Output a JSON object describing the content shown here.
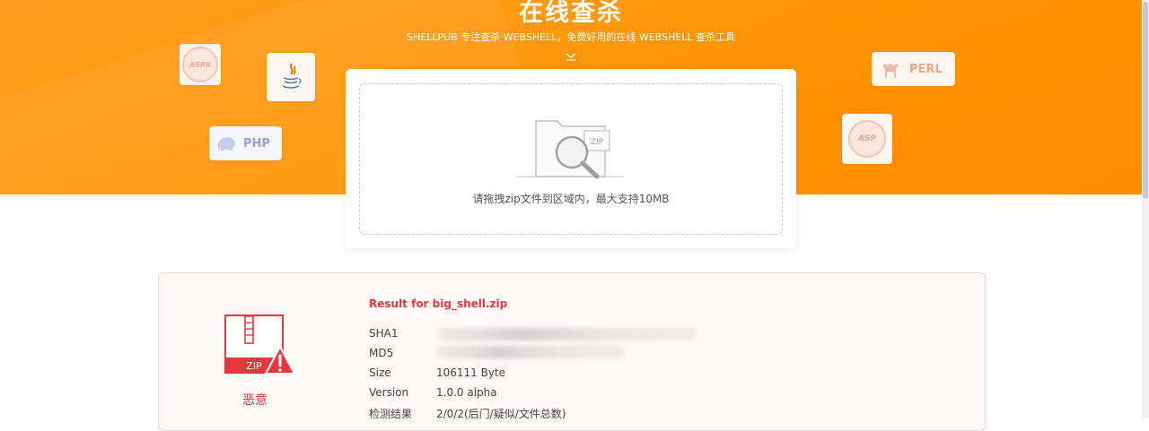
{
  "hero": {
    "title": "在线查杀",
    "subtitle": "SHELLPUB 专注查杀 WEBSHELL，免费好用的在线 WEBSHELL 查杀工具"
  },
  "badges": {
    "aspx": "ASPX",
    "php": "PHP",
    "perl": "PERL",
    "asp": "ASP"
  },
  "upload": {
    "hint": "请拖拽zip文件到区域内，最大支持10MB",
    "zip_tag": "ZIP"
  },
  "result": {
    "title": "Result for big_shell.zip",
    "verdict": "恶意",
    "zip_label": "ZIP",
    "fields": [
      {
        "label": "SHA1",
        "value": ""
      },
      {
        "label": "MD5",
        "value": ""
      },
      {
        "label": "Size",
        "value": "106111 Byte"
      },
      {
        "label": "Version",
        "value": "1.0.0 alpha"
      },
      {
        "label": "检测结果",
        "value": "2/0/2(后门/疑似/文件总数)"
      }
    ]
  },
  "colors": {
    "accent_orange": "#ff9200",
    "danger_red": "#e4393c"
  },
  "icons": [
    "chevron-down-icon",
    "java-icon",
    "php-elephant-icon",
    "perl-camel-icon",
    "folder-search-icon",
    "zip-file-warning-icon"
  ]
}
